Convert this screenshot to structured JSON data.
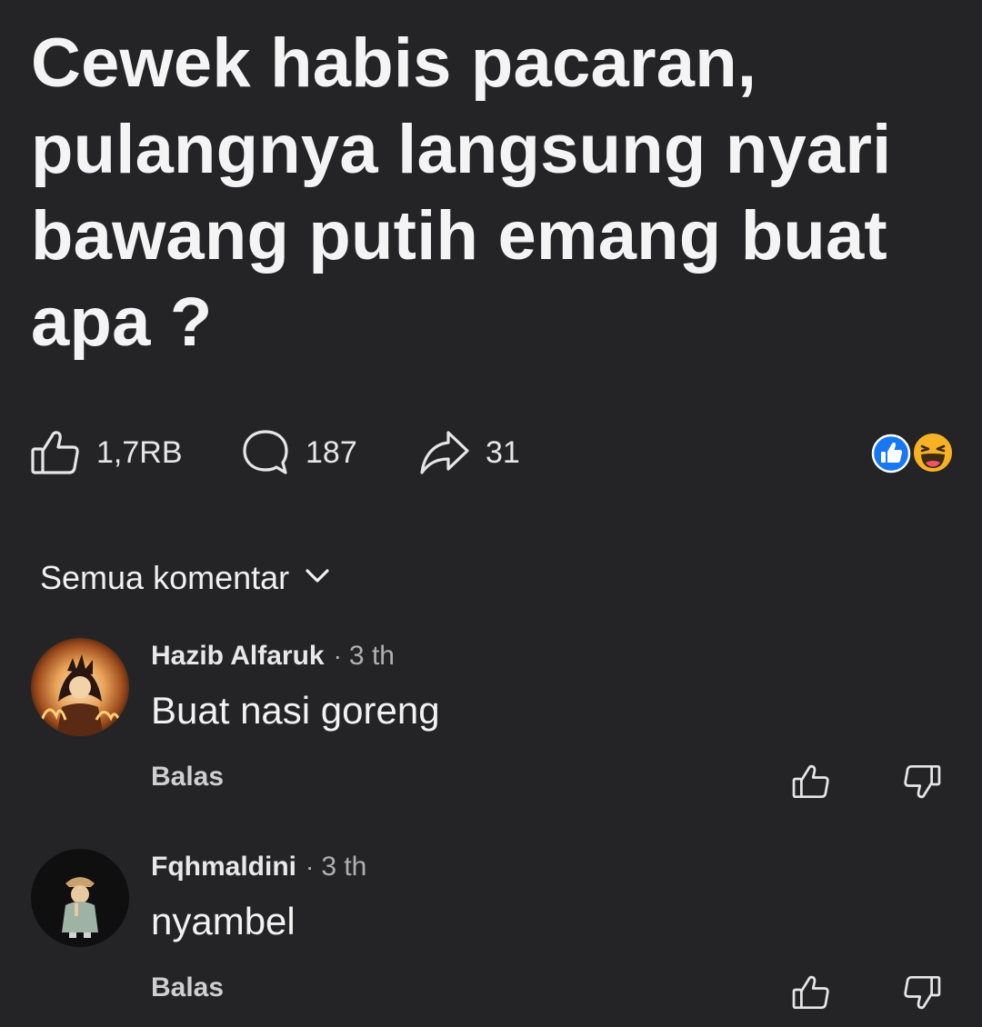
{
  "post": {
    "title_lines": [
      "Cewek habis pacaran,",
      "pulangnya langsung nyari",
      "bawang putih emang buat",
      "apa ?"
    ],
    "stats": {
      "likes": "1,7RB",
      "comments": "187",
      "shares": "31"
    },
    "reactions": [
      "like-reaction-icon",
      "haha-reaction-icon"
    ],
    "colors": {
      "background": "#242426",
      "like_reaction": "#1877f2",
      "haha_reaction": "#f7b125"
    }
  },
  "comments_section": {
    "filter_label": "Semua komentar",
    "comments": [
      {
        "author": "Hazib Alfaruk",
        "separator": "·",
        "time": "3 th",
        "text": "Buat nasi goreng",
        "reply_label": "Balas"
      },
      {
        "author": "Fqhmaldini",
        "separator": "·",
        "time": "3 th",
        "text": "nyambel",
        "reply_label": "Balas"
      }
    ]
  }
}
